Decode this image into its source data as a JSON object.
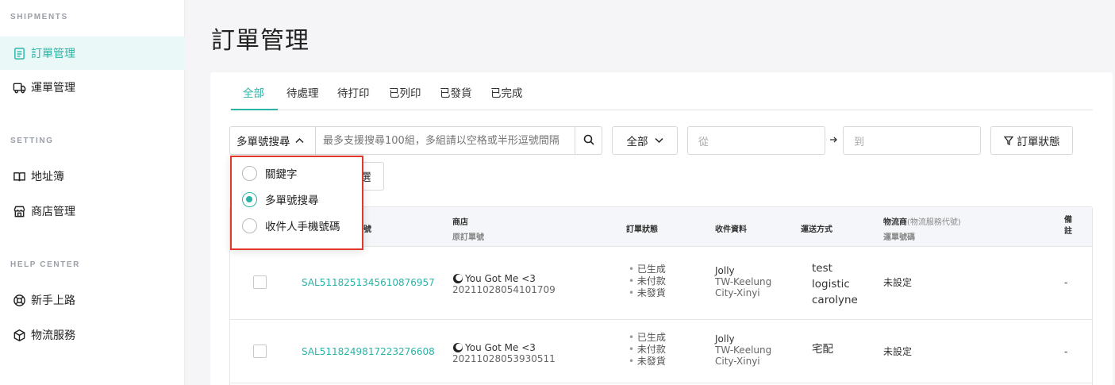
{
  "sidebar": {
    "sections": [
      {
        "title": "SHIPMENTS",
        "items": [
          {
            "label": "訂單管理",
            "icon": "document-list-icon",
            "active": true
          },
          {
            "label": "運單管理",
            "icon": "truck-icon",
            "active": false
          }
        ]
      },
      {
        "title": "SETTING",
        "items": [
          {
            "label": "地址簿",
            "icon": "book-icon",
            "active": false
          },
          {
            "label": "商店管理",
            "icon": "store-icon",
            "active": false
          }
        ]
      },
      {
        "title": "HELP CENTER",
        "items": [
          {
            "label": "新手上路",
            "icon": "lifebuoy-icon",
            "active": false
          },
          {
            "label": "物流服務",
            "icon": "package-icon",
            "active": false
          }
        ]
      }
    ]
  },
  "page": {
    "title": "訂單管理"
  },
  "tabs": [
    {
      "label": "全部",
      "active": true
    },
    {
      "label": "待處理",
      "active": false
    },
    {
      "label": "待打印",
      "active": false
    },
    {
      "label": "已列印",
      "active": false
    },
    {
      "label": "已發貨",
      "active": false
    },
    {
      "label": "已完成",
      "active": false
    }
  ],
  "filters": {
    "search_type": "多單號搜尋",
    "search_placeholder": "最多支援搜尋100組，多組請以空格或半形逗號間隔",
    "scope_select": "全部",
    "date_from_placeholder": "從",
    "date_to_placeholder": "到",
    "status_button": "訂單狀態",
    "hidden_button_fragment": "選"
  },
  "search_type_dropdown": {
    "options": [
      {
        "label": "關鍵字",
        "selected": false
      },
      {
        "label": "多單號搜尋",
        "selected": true
      },
      {
        "label": "收件人手機號碼",
        "selected": false
      }
    ]
  },
  "table": {
    "headers": {
      "order_no_fragment": "號",
      "store": "商店",
      "store_sub": "原訂單號",
      "status": "訂單狀態",
      "recipient": "收件資料",
      "shipping": "運送方式",
      "carrier": "物流商",
      "carrier_paren": "(物流服務代號)",
      "carrier_sub": "運單號碼",
      "remark_1": "備",
      "remark_2": "註"
    },
    "rows": [
      {
        "order_no": "SAL5118251345610876957",
        "store": "You Got Me <3",
        "original_no": "20211028054101709",
        "status": [
          "已生成",
          "未付款",
          "未發貨"
        ],
        "recipient_name": "Jolly",
        "recipient_addr_1": "TW-Keelung",
        "recipient_addr_2": "City-Xinyi",
        "shipping_1": "test",
        "shipping_2": "logistic",
        "shipping_3": "carolyne",
        "carrier": "未設定",
        "remark": "-"
      },
      {
        "order_no": "SAL5118249817223276608",
        "store": "You Got Me <3",
        "original_no": "20211028053930511",
        "status": [
          "已生成",
          "未付款",
          "未發貨"
        ],
        "recipient_name": "Jolly",
        "recipient_addr_1": "TW-Keelung",
        "recipient_addr_2": "City-Xinyi",
        "shipping_1": "宅配",
        "carrier": "未設定",
        "remark": "-"
      }
    ]
  },
  "colors": {
    "accent": "#2bb3a6",
    "highlight_border": "#e2372b"
  }
}
